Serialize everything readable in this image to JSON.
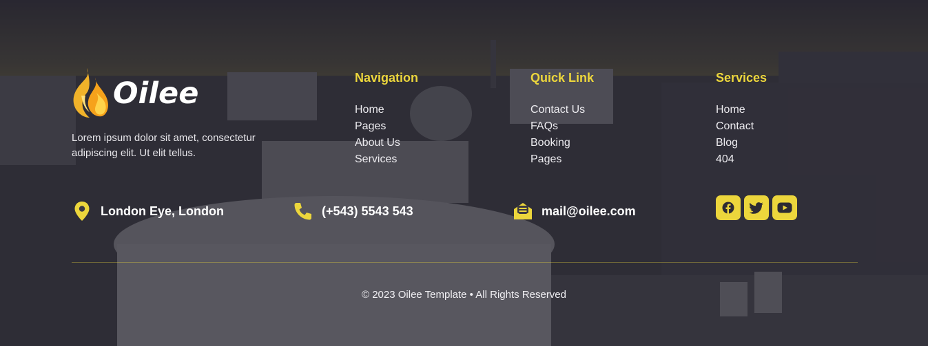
{
  "brand": {
    "name": "Oilee",
    "accent": "#ecd63c"
  },
  "about": {
    "text": "Lorem ipsum dolor sit amet, consectetur adipiscing elit. Ut elit tellus."
  },
  "navigation": {
    "title": "Navigation",
    "items": [
      "Home",
      "Pages",
      "About Us",
      "Services"
    ]
  },
  "quick_link": {
    "title": "Quick Link",
    "items": [
      "Contact Us",
      "FAQs",
      "Booking",
      "Pages"
    ]
  },
  "services": {
    "title": "Services",
    "items": [
      "Home",
      "Contact",
      "Blog",
      "404"
    ]
  },
  "contact": {
    "location": {
      "icon": "map-pin-icon",
      "text": "London Eye, London"
    },
    "phone": {
      "icon": "phone-icon",
      "text": "(+543) 5543 543"
    },
    "email": {
      "icon": "envelope-icon",
      "text": "mail@oilee.com"
    }
  },
  "social": [
    "facebook-icon",
    "twitter-icon",
    "youtube-icon"
  ],
  "footer": {
    "copyright": "© 2023 Oilee Template • All Rights Reserved"
  }
}
